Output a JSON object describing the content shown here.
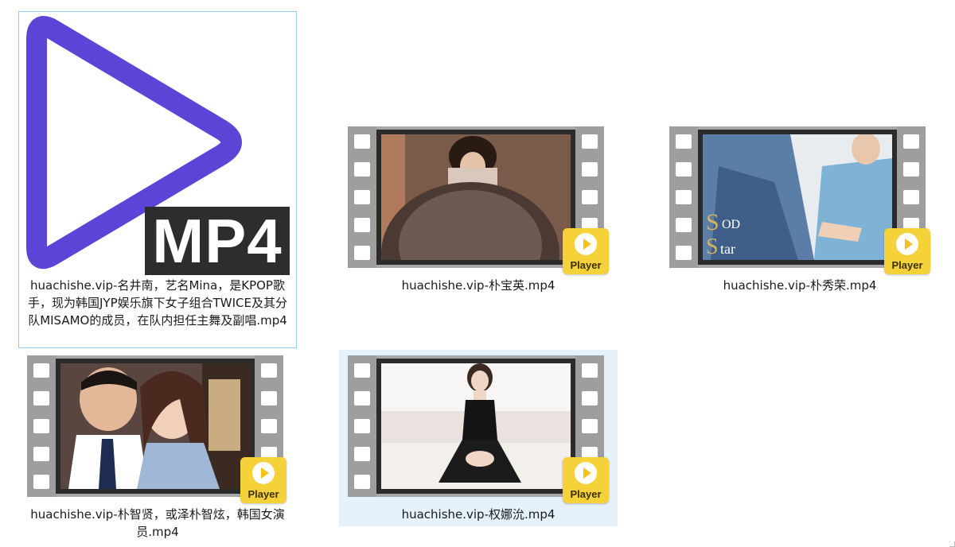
{
  "files": [
    {
      "name": "huachishe.vip-名井南，艺名Mina，是KPOP歌手，现为韩国JYP娱乐旗下女子组合TWICE及其分队MISAMO的成员，在队内担任主舞及副唱.mp4",
      "thumbnail": "mp4-icon",
      "icon_label": "MP4",
      "state": "focused"
    },
    {
      "name": "huachishe.vip-朴宝英.mp4",
      "thumbnail": "video-frame",
      "badge": "Player",
      "state": "normal"
    },
    {
      "name": "huachishe.vip-朴秀荣.mp4",
      "thumbnail": "video-frame",
      "badge": "Player",
      "state": "normal"
    },
    {
      "name": "huachishe.vip-朴智贤，或泽朴智炫，韩国女演员.mp4",
      "thumbnail": "video-frame",
      "badge": "Player",
      "state": "normal"
    },
    {
      "name": "huachishe.vip-权娜沇.mp4",
      "thumbnail": "video-frame",
      "badge": "Player",
      "state": "hovered"
    }
  ],
  "colors": {
    "focus_border": "#99c9f2",
    "hover_background": "#e5f1fb",
    "play_icon_purple": "#5b45d6",
    "player_badge_yellow": "#f6d23a",
    "film_gray": "#9e9e9e"
  }
}
